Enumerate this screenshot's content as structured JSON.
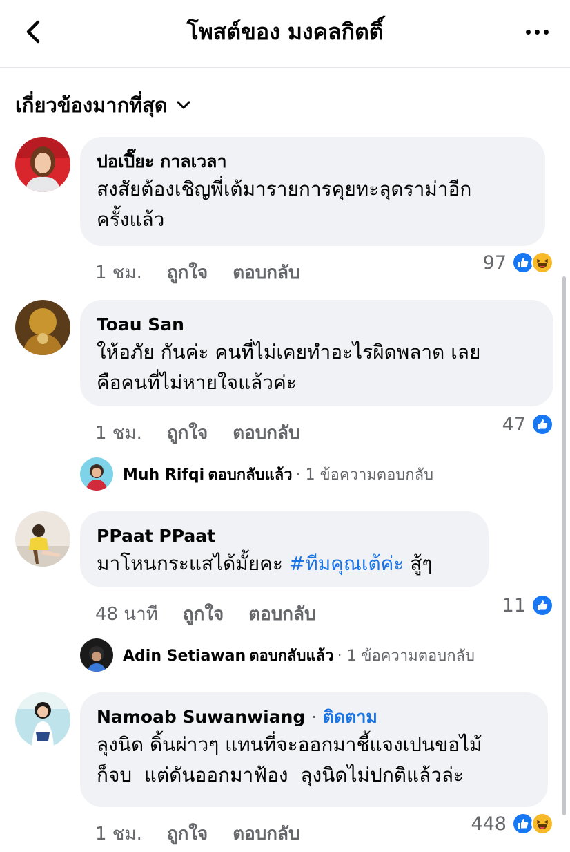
{
  "header": {
    "title": "โพสต์ของ มงคลกิตติ์"
  },
  "sort": {
    "label": "เกี่ยวข้องมากที่สุด"
  },
  "comments": [
    {
      "name": "ปอเปี๊ยะ กาลเวลา",
      "text_line1": "สงสัยต้องเชิญพี่เต้มารายการคุยทะลุดราม่าอีก",
      "text_line2": "ครั้งแล้ว",
      "time": "1 ชม.",
      "like_label": "ถูกใจ",
      "reply_label": "ตอบกลับ",
      "reaction_count": "97"
    },
    {
      "name": "Toau San",
      "text_line1": "ให้อภัย กันค่ะ คนที่ไม่เคยทำอะไรผิดพลาด เลย",
      "text_line2": "คือคนที่ไม่หายใจแล้วค่ะ",
      "time": "1 ชม.",
      "like_label": "ถูกใจ",
      "reply_label": "ตอบกลับ",
      "reaction_count": "47",
      "reply_preview": {
        "name": "Muh Rifqi",
        "action": "ตอบกลับแล้ว",
        "count_text": "· 1 ข้อความตอบกลับ"
      }
    },
    {
      "name": "PPaat PPaat",
      "text_main": "มาโหนกระแสได้มั้ยคะ",
      "hashtag": "#ทีมคุณเต้ค่ะ",
      "text_tail": "สู้ๆ",
      "time": "48 นาที",
      "like_label": "ถูกใจ",
      "reply_label": "ตอบกลับ",
      "reaction_count": "11",
      "reply_preview": {
        "name": "Adin Setiawan",
        "action": "ตอบกลับแล้ว",
        "count_text": "· 1 ข้อความตอบกลับ"
      }
    },
    {
      "name": "Namoab Suwanwiang",
      "follow_dot": "·",
      "follow_label": "ติดตาม",
      "text_line1": "ลุงนิด ดิ้นผ่าวๆ แทนที่จะออกมาชี้แจงเปนขอไม้",
      "text_line2": "ก็จบ  แต่ดันออกมาฟ้อง  ลุงนิดไม่ปกติแล้วล่ะ",
      "time": "1 ชม.",
      "like_label": "ถูกใจ",
      "reply_label": "ตอบกลับ",
      "reaction_count": "448"
    }
  ],
  "colors": {
    "link_blue": "#1b74e4",
    "bubble_bg": "#f0f2f5",
    "meta_gray": "#65676b",
    "like_blue": "#1877f2",
    "haha_yellow": "#f7b928"
  }
}
